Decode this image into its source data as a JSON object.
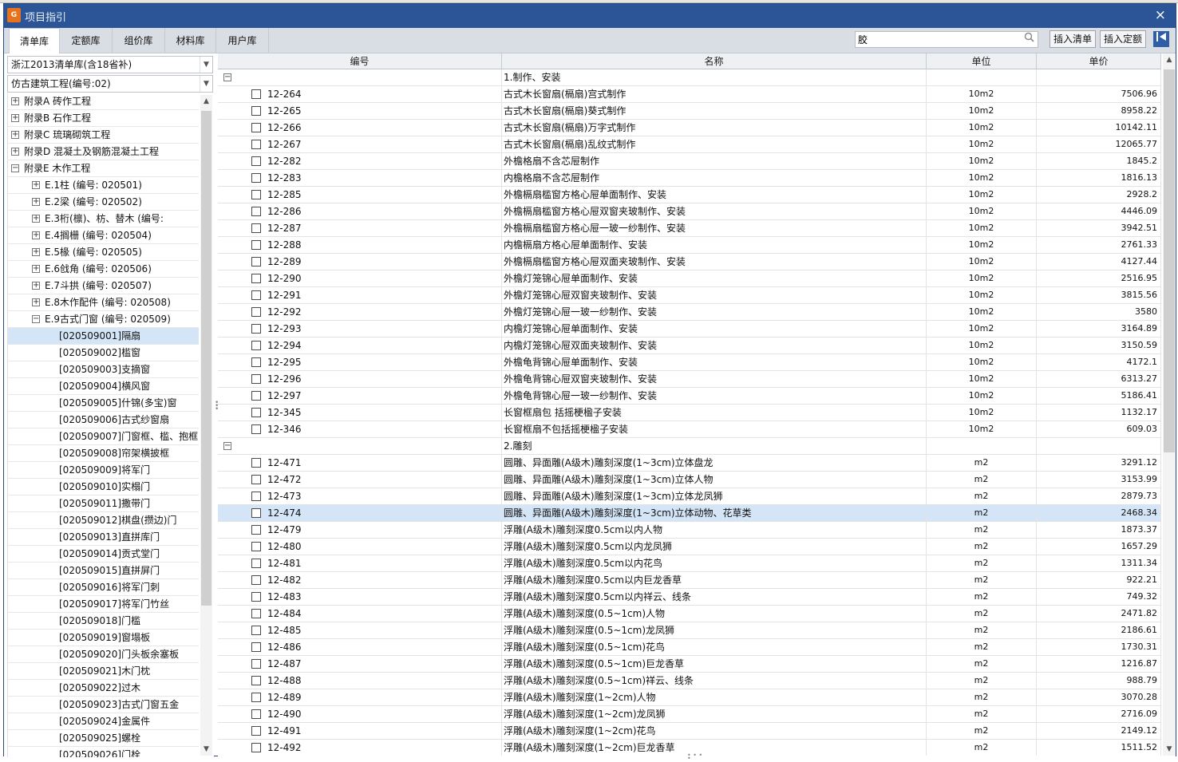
{
  "window": {
    "title": "项目指引",
    "close": "×",
    "app_icon_text": "G"
  },
  "tabs": [
    "清单库",
    "定额库",
    "组价库",
    "材料库",
    "用户库"
  ],
  "search": {
    "value": "胶",
    "placeholder": ""
  },
  "buttons": {
    "insert_list": "插入清单",
    "insert_quota": "插入定额"
  },
  "left": {
    "library": "浙江2013清单库(含18省补)",
    "project": "仿古建筑工程(编号:02)",
    "tree": [
      {
        "label": "附录A 砖作工程",
        "level": 0,
        "state": "+"
      },
      {
        "label": "附录B 石作工程",
        "level": 0,
        "state": "+"
      },
      {
        "label": "附录C 琉璃砌筑工程",
        "level": 0,
        "state": "+"
      },
      {
        "label": "附录D 混凝土及钢筋混凝土工程",
        "level": 0,
        "state": "+"
      },
      {
        "label": "附录E 木作工程",
        "level": 0,
        "state": "-"
      },
      {
        "label": "E.1柱 (编号: 020501)",
        "level": 1,
        "state": "+"
      },
      {
        "label": "E.2梁 (编号: 020502)",
        "level": 1,
        "state": "+"
      },
      {
        "label": "E.3桁(檩)、枋、替木 (编号:",
        "level": 1,
        "state": "+"
      },
      {
        "label": "E.4搁栅 (编号: 020504)",
        "level": 1,
        "state": "+"
      },
      {
        "label": "E.5椽 (编号: 020505)",
        "level": 1,
        "state": "+"
      },
      {
        "label": "E.6戗角 (编号: 020506)",
        "level": 1,
        "state": "+"
      },
      {
        "label": "E.7斗拱 (编号: 020507)",
        "level": 1,
        "state": "+"
      },
      {
        "label": "E.8木作配件 (编号: 020508)",
        "level": 1,
        "state": "+"
      },
      {
        "label": "E.9古式门窗 (编号: 020509)",
        "level": 1,
        "state": "-"
      },
      {
        "label": "[020509001]隔扇",
        "level": 2,
        "state": "",
        "selected": true
      },
      {
        "label": "[020509002]槛窗",
        "level": 2,
        "state": ""
      },
      {
        "label": "[020509003]支摘窗",
        "level": 2,
        "state": ""
      },
      {
        "label": "[020509004]横风窗",
        "level": 2,
        "state": ""
      },
      {
        "label": "[020509005]什锦(多宝)窗",
        "level": 2,
        "state": ""
      },
      {
        "label": "[020509006]古式纱窗扇",
        "level": 2,
        "state": ""
      },
      {
        "label": "[020509007]门窗框、槛、抱框",
        "level": 2,
        "state": ""
      },
      {
        "label": "[020509008]帘架横披框",
        "level": 2,
        "state": ""
      },
      {
        "label": "[020509009]将军门",
        "level": 2,
        "state": ""
      },
      {
        "label": "[020509010]实榻门",
        "level": 2,
        "state": ""
      },
      {
        "label": "[020509011]撒带门",
        "level": 2,
        "state": ""
      },
      {
        "label": "[020509012]棋盘(攒边)门",
        "level": 2,
        "state": ""
      },
      {
        "label": "[020509013]直拼库门",
        "level": 2,
        "state": ""
      },
      {
        "label": "[020509014]贡式堂门",
        "level": 2,
        "state": ""
      },
      {
        "label": "[020509015]直拼屏门",
        "level": 2,
        "state": ""
      },
      {
        "label": "[020509016]将军门刺",
        "level": 2,
        "state": ""
      },
      {
        "label": "[020509017]将军门竹丝",
        "level": 2,
        "state": ""
      },
      {
        "label": "[020509018]门槛",
        "level": 2,
        "state": ""
      },
      {
        "label": "[020509019]窗塌板",
        "level": 2,
        "state": ""
      },
      {
        "label": "[020509020]门头板余塞板",
        "level": 2,
        "state": ""
      },
      {
        "label": "[020509021]木门枕",
        "level": 2,
        "state": ""
      },
      {
        "label": "[020509022]过木",
        "level": 2,
        "state": ""
      },
      {
        "label": "[020509023]古式门窗五金",
        "level": 2,
        "state": ""
      },
      {
        "label": "[020509024]金属件",
        "level": 2,
        "state": ""
      },
      {
        "label": "[020509025]螺栓",
        "level": 2,
        "state": ""
      },
      {
        "label": "[020509026]门栓",
        "level": 2,
        "state": ""
      }
    ]
  },
  "grid": {
    "columns": [
      "编号",
      "名称",
      "单位",
      "单价"
    ],
    "rows": [
      {
        "group": true,
        "name": "1.制作、安装"
      },
      {
        "code": "12-264",
        "name": "古式木长窗扇(槅扇)宫式制作",
        "unit": "10m2",
        "price": "7506.96"
      },
      {
        "code": "12-265",
        "name": "古式木长窗扇(槅扇)葵式制作",
        "unit": "10m2",
        "price": "8958.22"
      },
      {
        "code": "12-266",
        "name": "古式木长窗扇(槅扇)万字式制作",
        "unit": "10m2",
        "price": "10142.11"
      },
      {
        "code": "12-267",
        "name": "古式木长窗扇(槅扇)乱纹式制作",
        "unit": "10m2",
        "price": "12065.77"
      },
      {
        "code": "12-282",
        "name": "外檐格扇不含芯屉制作",
        "unit": "10m2",
        "price": "1845.2"
      },
      {
        "code": "12-283",
        "name": "内檐格扇不含芯屉制作",
        "unit": "10m2",
        "price": "1816.13"
      },
      {
        "code": "12-285",
        "name": "外檐槅扇槛窗方格心屉单面制作、安装",
        "unit": "10m2",
        "price": "2928.2"
      },
      {
        "code": "12-286",
        "name": "外檐槅扇槛窗方格心屉双窗夹玻制作、安装",
        "unit": "10m2",
        "price": "4446.09"
      },
      {
        "code": "12-287",
        "name": "外檐槅扇槛窗方格心屉一玻一纱制作、安装",
        "unit": "10m2",
        "price": "3942.51"
      },
      {
        "code": "12-288",
        "name": "内檐槅扇方格心屉单面制作、安装",
        "unit": "10m2",
        "price": "2761.33"
      },
      {
        "code": "12-289",
        "name": "外檐槅扇槛窗方格心屉双面夹玻制作、安装",
        "unit": "10m2",
        "price": "4127.44"
      },
      {
        "code": "12-290",
        "name": "外檐灯笼锦心屉单面制作、安装",
        "unit": "10m2",
        "price": "2516.95"
      },
      {
        "code": "12-291",
        "name": "外檐灯笼锦心屉双窗夹玻制作、安装",
        "unit": "10m2",
        "price": "3815.56"
      },
      {
        "code": "12-292",
        "name": "外檐灯笼锦心屉一玻一纱制作、安装",
        "unit": "10m2",
        "price": "3580"
      },
      {
        "code": "12-293",
        "name": "内檐灯笼锦心屉单面制作、安装",
        "unit": "10m2",
        "price": "3164.89"
      },
      {
        "code": "12-294",
        "name": "内檐灯笼锦心屉双面夹玻制作、安装",
        "unit": "10m2",
        "price": "3150.59"
      },
      {
        "code": "12-295",
        "name": "外檐龟背锦心屉单面制作、安装",
        "unit": "10m2",
        "price": "4172.1"
      },
      {
        "code": "12-296",
        "name": "外檐龟背锦心屉双窗夹玻制作、安装",
        "unit": "10m2",
        "price": "6313.27"
      },
      {
        "code": "12-297",
        "name": "外檐龟背锦心屉一玻一纱制作、安装",
        "unit": "10m2",
        "price": "5186.41"
      },
      {
        "code": "12-345",
        "name": "长窗框扇包 括摇梗楹子安装",
        "unit": "10m2",
        "price": "1132.17"
      },
      {
        "code": "12-346",
        "name": "长窗框扇不包括摇梗楹子安装",
        "unit": "10m2",
        "price": "609.03"
      },
      {
        "group": true,
        "name": "2.雕刻"
      },
      {
        "code": "12-471",
        "name": "圆雕、异面雕(A级木)雕刻深度(1~3cm)立体盘龙",
        "unit": "m2",
        "price": "3291.12"
      },
      {
        "code": "12-472",
        "name": "圆雕、异面雕(A级木)雕刻深度(1~3cm)立体人物",
        "unit": "m2",
        "price": "3153.99"
      },
      {
        "code": "12-473",
        "name": "圆雕、异面雕(A级木)雕刻深度(1~3cm)立体龙凤狮",
        "unit": "m2",
        "price": "2879.73"
      },
      {
        "code": "12-474",
        "name": "圆雕、异面雕(A级木)雕刻深度(1~3cm)立体动物、花草类",
        "unit": "m2",
        "price": "2468.34",
        "selected": true
      },
      {
        "code": "12-479",
        "name": "浮雕(A级木)雕刻深度0.5cm以内人物",
        "unit": "m2",
        "price": "1873.37"
      },
      {
        "code": "12-480",
        "name": "浮雕(A级木)雕刻深度0.5cm以内龙凤狮",
        "unit": "m2",
        "price": "1657.29"
      },
      {
        "code": "12-481",
        "name": "浮雕(A级木)雕刻深度0.5cm以内花鸟",
        "unit": "m2",
        "price": "1311.34"
      },
      {
        "code": "12-482",
        "name": "浮雕(A级木)雕刻深度0.5cm以内巨龙香草",
        "unit": "m2",
        "price": "922.21"
      },
      {
        "code": "12-483",
        "name": "浮雕(A级木)雕刻深度0.5cm以内祥云、线条",
        "unit": "m2",
        "price": "749.32"
      },
      {
        "code": "12-484",
        "name": "浮雕(A级木)雕刻深度(0.5~1cm)人物",
        "unit": "m2",
        "price": "2471.82"
      },
      {
        "code": "12-485",
        "name": "浮雕(A级木)雕刻深度(0.5~1cm)龙凤狮",
        "unit": "m2",
        "price": "2186.61"
      },
      {
        "code": "12-486",
        "name": "浮雕(A级木)雕刻深度(0.5~1cm)花鸟",
        "unit": "m2",
        "price": "1730.31"
      },
      {
        "code": "12-487",
        "name": "浮雕(A级木)雕刻深度(0.5~1cm)巨龙香草",
        "unit": "m2",
        "price": "1216.87"
      },
      {
        "code": "12-488",
        "name": "浮雕(A级木)雕刻深度(0.5~1cm)祥云、线条",
        "unit": "m2",
        "price": "988.79"
      },
      {
        "code": "12-489",
        "name": "浮雕(A级木)雕刻深度(1~2cm)人物",
        "unit": "m2",
        "price": "3070.28"
      },
      {
        "code": "12-490",
        "name": "浮雕(A级木)雕刻深度(1~2cm)龙凤狮",
        "unit": "m2",
        "price": "2716.09"
      },
      {
        "code": "12-491",
        "name": "浮雕(A级木)雕刻深度(1~2cm)花鸟",
        "unit": "m2",
        "price": "2149.12"
      },
      {
        "code": "12-492",
        "name": "浮雕(A级木)雕刻深度(1~2cm)巨龙香草",
        "unit": "m2",
        "price": "1511.52"
      }
    ]
  },
  "colors": {
    "titlebar": "#2b5597",
    "selection": "#d4e5f7",
    "app_icon": "#e8731c"
  }
}
